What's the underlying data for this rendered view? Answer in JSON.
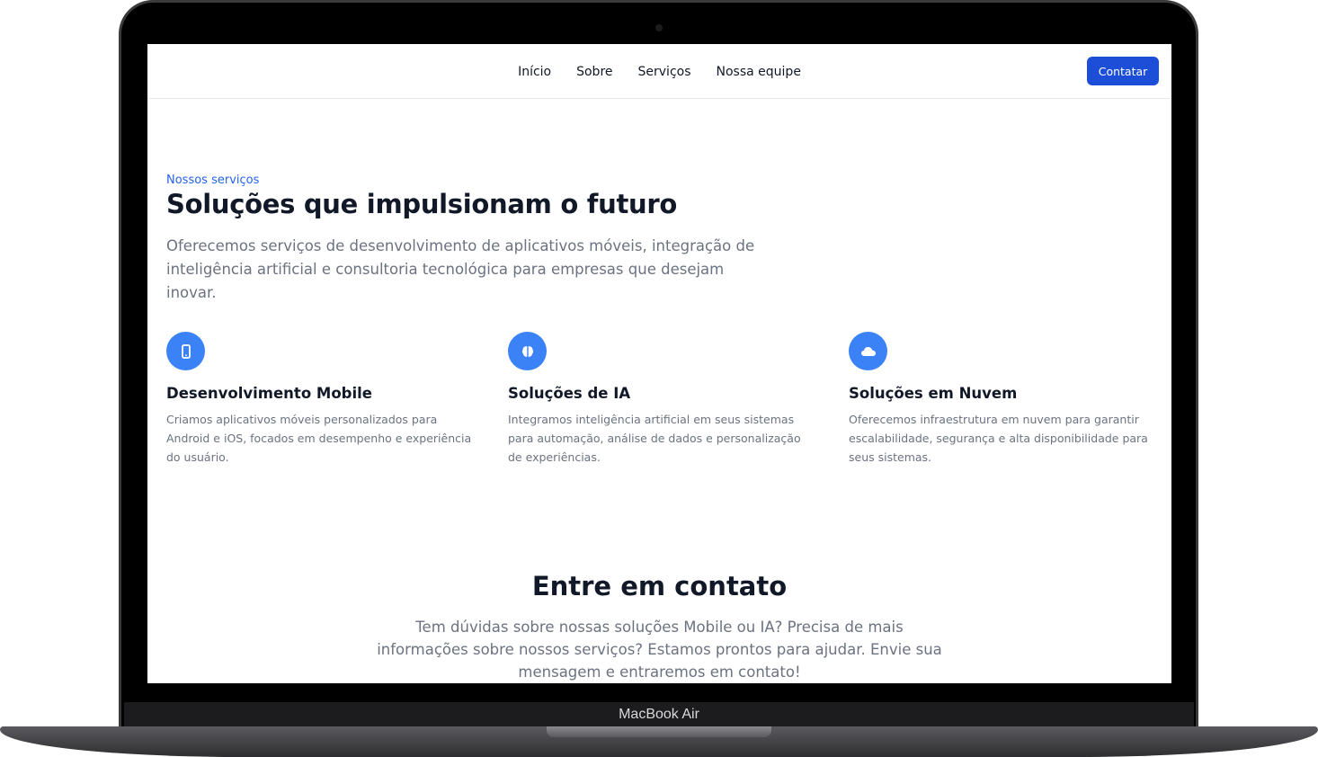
{
  "device": {
    "label": "MacBook Air"
  },
  "nav": {
    "links": [
      "Início",
      "Sobre",
      "Serviços",
      "Nossa equipe"
    ],
    "cta": "Contatar"
  },
  "hero": {
    "eyebrow": "Nossos serviços",
    "title": "Soluções que impulsionam o futuro",
    "description": "Oferecemos serviços de desenvolvimento de aplicativos móveis, integração de inteligência artificial e consultoria tecnológica para empresas que desejam inovar."
  },
  "services": [
    {
      "icon": "smartphone-icon",
      "title": "Desenvolvimento Mobile",
      "description": "Criamos aplicativos móveis personalizados para Android e iOS, focados em desempenho e experiência do usuário."
    },
    {
      "icon": "brain-icon",
      "title": "Soluções de IA",
      "description": "Integramos inteligência artificial em seus sistemas para automação, análise de dados e personalização de experiências."
    },
    {
      "icon": "cloud-icon",
      "title": "Soluções em Nuvem",
      "description": "Oferecemos infraestrutura em nuvem para garantir escalabilidade, segurança e alta disponibilidade para seus sistemas."
    }
  ],
  "contact": {
    "title": "Entre em contato",
    "description": "Tem dúvidas sobre nossas soluções Mobile ou IA? Precisa de mais informações sobre nossos serviços? Estamos prontos para ajudar. Envie sua mensagem e entraremos em contato!"
  },
  "colors": {
    "accent": "#1d4ed8",
    "icon_bg": "#3b82f6",
    "eyebrow": "#2563eb",
    "heading": "#111827",
    "body_text": "#6b7280"
  }
}
